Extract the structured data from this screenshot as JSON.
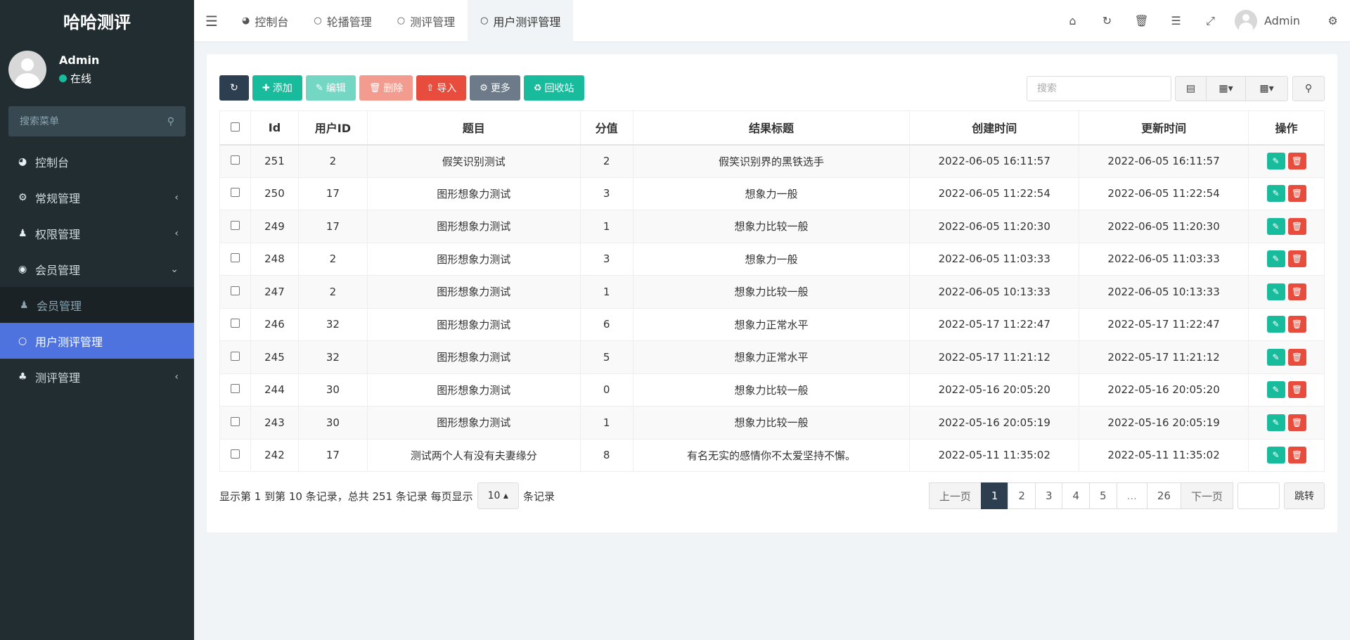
{
  "sidebar": {
    "brand": "哈哈测评",
    "user": {
      "name": "Admin",
      "status": "在线"
    },
    "search_placeholder": "搜索菜单",
    "items": [
      {
        "label": "控制台",
        "icon": "dashboard-icon",
        "arrow": ""
      },
      {
        "label": "常规管理",
        "icon": "cogs-icon",
        "arrow": "‹"
      },
      {
        "label": "权限管理",
        "icon": "group-icon",
        "arrow": "‹"
      },
      {
        "label": "会员管理",
        "icon": "user-circle-icon",
        "arrow": "⌄"
      },
      {
        "label": "会员管理",
        "icon": "user-icon",
        "arrow": ""
      },
      {
        "label": "用户测评管理",
        "icon": "circle-icon",
        "arrow": ""
      },
      {
        "label": "测评管理",
        "icon": "tree-icon",
        "arrow": "‹"
      }
    ]
  },
  "header": {
    "tabs": [
      {
        "label": "控制台"
      },
      {
        "label": "轮播管理"
      },
      {
        "label": "测评管理"
      },
      {
        "label": "用户测评管理"
      }
    ],
    "user_name": "Admin"
  },
  "toolbar": {
    "add": "添加",
    "edit": "编辑",
    "delete": "删除",
    "import": "导入",
    "more": "更多",
    "recycle": "回收站",
    "search_placeholder": "搜索"
  },
  "table": {
    "columns": [
      "Id",
      "用户ID",
      "题目",
      "分值",
      "结果标题",
      "创建时间",
      "更新时间",
      "操作"
    ],
    "rows": [
      [
        "251",
        "2",
        "假笑识别测试",
        "2",
        "假笑识别界的黑铁选手",
        "2022-06-05 16:11:57",
        "2022-06-05 16:11:57"
      ],
      [
        "250",
        "17",
        "图形想象力测试",
        "3",
        "想象力一般",
        "2022-06-05 11:22:54",
        "2022-06-05 11:22:54"
      ],
      [
        "249",
        "17",
        "图形想象力测试",
        "1",
        "想象力比较一般",
        "2022-06-05 11:20:30",
        "2022-06-05 11:20:30"
      ],
      [
        "248",
        "2",
        "图形想象力测试",
        "3",
        "想象力一般",
        "2022-06-05 11:03:33",
        "2022-06-05 11:03:33"
      ],
      [
        "247",
        "2",
        "图形想象力测试",
        "1",
        "想象力比较一般",
        "2022-06-05 10:13:33",
        "2022-06-05 10:13:33"
      ],
      [
        "246",
        "32",
        "图形想象力测试",
        "6",
        "想象力正常水平",
        "2022-05-17 11:22:47",
        "2022-05-17 11:22:47"
      ],
      [
        "245",
        "32",
        "图形想象力测试",
        "5",
        "想象力正常水平",
        "2022-05-17 11:21:12",
        "2022-05-17 11:21:12"
      ],
      [
        "244",
        "30",
        "图形想象力测试",
        "0",
        "想象力比较一般",
        "2022-05-16 20:05:20",
        "2022-05-16 20:05:20"
      ],
      [
        "243",
        "30",
        "图形想象力测试",
        "1",
        "想象力比较一般",
        "2022-05-16 20:05:19",
        "2022-05-16 20:05:19"
      ],
      [
        "242",
        "17",
        "测试两个人有没有夫妻缘分",
        "8",
        "有名无实的感情你不太爱坚持不懈。",
        "2022-05-11 11:35:02",
        "2022-05-11 11:35:02"
      ]
    ]
  },
  "footer": {
    "summary": "显示第 1 到第 10 条记录，总共 251 条记录 每页显示",
    "page_size": "10",
    "suffix": "条记录"
  },
  "pagination": {
    "prev": "上一页",
    "pages": [
      "1",
      "2",
      "3",
      "4",
      "5",
      "...",
      "26"
    ],
    "active": "1",
    "next": "下一页",
    "jump": "跳转"
  },
  "colors": {
    "sidebar_bg": "#222d32",
    "active_menu": "#4e73df",
    "primary_dark": "#2c3e50",
    "success": "#18bc9c",
    "danger": "#e74c3c"
  }
}
